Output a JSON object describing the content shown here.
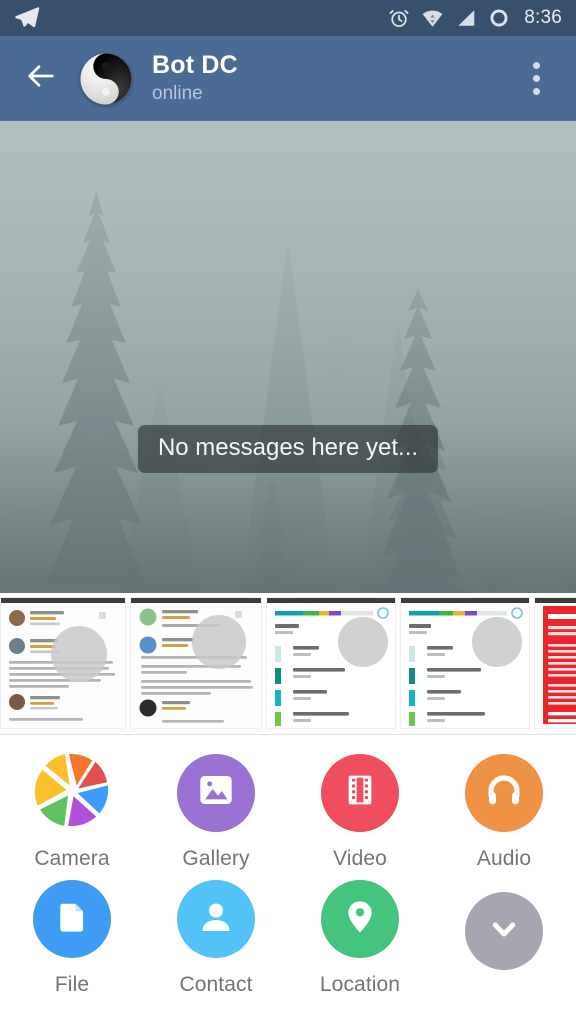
{
  "status_bar": {
    "app_icon": "telegram-plane-icon",
    "icons": [
      "alarm-clock-icon",
      "wifi-icon",
      "cell-signal-icon",
      "battery-ring-icon"
    ],
    "time": "8:36",
    "background_color": "#37506e"
  },
  "app_bar": {
    "back_icon": "back-arrow-icon",
    "avatar_icon": "yin-yang-avatar",
    "title": "Bot DC",
    "status": "online",
    "overflow_icon": "more-vertical-icon",
    "background_color": "#4a6b94"
  },
  "chat": {
    "empty_text": "No messages here yet...",
    "wallpaper": "foggy-pine-forest"
  },
  "photo_strip": {
    "thumbnails": [
      {
        "name": "thumbnail-app-reviews-1",
        "kind": "reviews"
      },
      {
        "name": "thumbnail-app-reviews-2",
        "kind": "reviews"
      },
      {
        "name": "thumbnail-storage-usage-1",
        "kind": "storage"
      },
      {
        "name": "thumbnail-storage-usage-2",
        "kind": "storage"
      },
      {
        "name": "thumbnail-warning-page",
        "kind": "warning"
      }
    ]
  },
  "attach_menu": {
    "items": [
      {
        "label": "Camera",
        "icon": "camera-aperture-icon",
        "color": "#ffffff"
      },
      {
        "label": "Gallery",
        "icon": "gallery-image-icon",
        "color": "#9b72d4"
      },
      {
        "label": "Video",
        "icon": "video-film-icon",
        "color": "#ef4e5e"
      },
      {
        "label": "Audio",
        "icon": "audio-headphones-icon",
        "color": "#f09246"
      },
      {
        "label": "File",
        "icon": "file-document-icon",
        "color": "#3f9cf5"
      },
      {
        "label": "Contact",
        "icon": "contact-person-icon",
        "color": "#51c3f7"
      },
      {
        "label": "Location",
        "icon": "location-pin-icon",
        "color": "#44c47d"
      },
      {
        "label": "",
        "icon": "chevron-down-icon",
        "color": "#a9a5b0"
      }
    ]
  }
}
